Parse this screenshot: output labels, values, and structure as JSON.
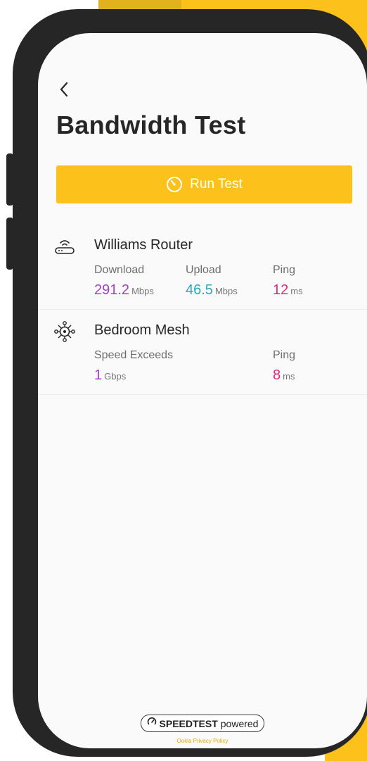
{
  "header": {
    "title": "Bandwidth Test",
    "back_icon": "chevron-left-icon"
  },
  "run_button": {
    "label": "Run Test",
    "icon": "speedometer-icon"
  },
  "devices": [
    {
      "name": "Williams Router",
      "icon": "router-icon",
      "metrics": [
        {
          "label": "Download",
          "value": "291.2",
          "unit": "Mbps",
          "color": "#a541c8"
        },
        {
          "label": "Upload",
          "value": "46.5",
          "unit": "Mbps",
          "color": "#26a8c3"
        },
        {
          "label": "Ping",
          "value": "12",
          "unit": "ms",
          "color": "#e4287a"
        }
      ]
    },
    {
      "name": "Bedroom Mesh",
      "icon": "mesh-node-icon",
      "metrics": [
        {
          "label": "Speed Exceeds",
          "value": "1",
          "unit": "Gbps",
          "color": "#a541c8"
        },
        {
          "label": "Ping",
          "value": "8",
          "unit": "ms",
          "color": "#e4287a"
        }
      ]
    }
  ],
  "footer": {
    "brand": "SPEEDTEST",
    "powered": "powered",
    "privacy_link": "Ookla Privacy Policy"
  },
  "colors": {
    "accent": "#fcc21b",
    "download": "#a541c8",
    "upload": "#26a8c3",
    "ping": "#e4287a"
  }
}
